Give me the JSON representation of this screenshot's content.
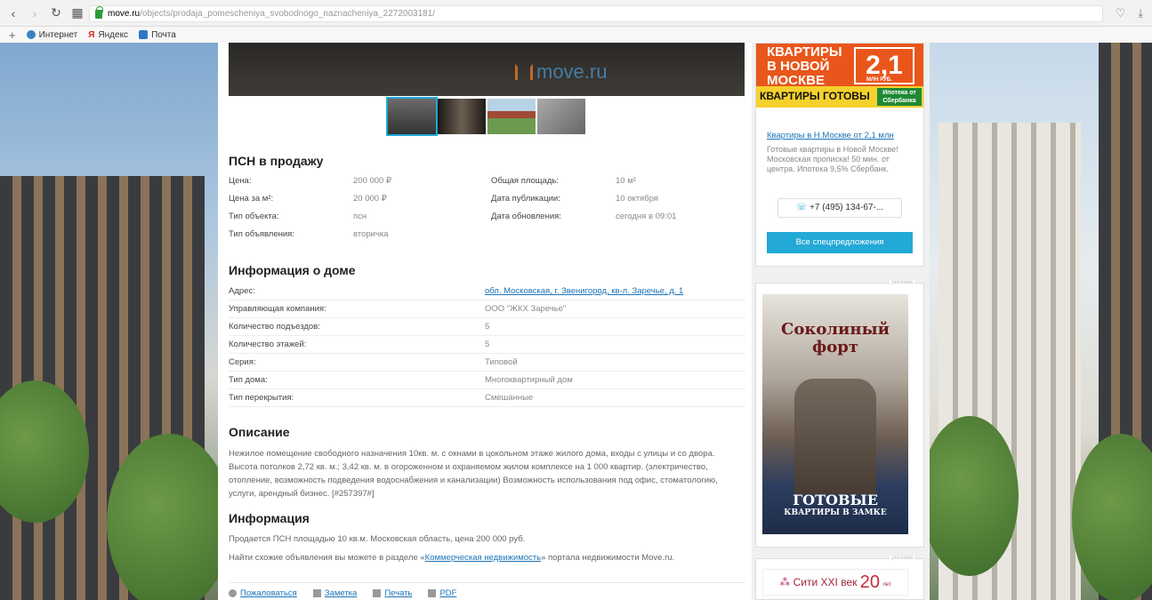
{
  "browser": {
    "url_host": "move.ru",
    "url_path": "/objects/prodaja_pomescheniya_svobodnogo_naznacheniya_2272003181/",
    "bookmarks": [
      "Интернет",
      "Яндекс",
      "Почта"
    ]
  },
  "listing": {
    "title": "ПСН в продажу",
    "details": [
      {
        "label": "Цена:",
        "value": "200 000 ₽"
      },
      {
        "label": "Цена за м²:",
        "value": "20 000 ₽"
      },
      {
        "label": "Тип объекта:",
        "value": "псн"
      },
      {
        "label": "Тип объявления:",
        "value": "вторичка"
      }
    ],
    "details_right": [
      {
        "label": "Общая площадь:",
        "value": "10 м²"
      },
      {
        "label": "Дата публикации:",
        "value": "10 октября"
      },
      {
        "label": "Дата обновления:",
        "value": "сегодня в 09:01"
      }
    ]
  },
  "house": {
    "title": "Информация о доме",
    "rows": [
      {
        "label": "Адрес:",
        "value": "обл. Московская, г. Звенигород, кв-л. Заречье, д. 1"
      },
      {
        "label": "Управляющая компания:",
        "value": "ООО \"ЖКХ Заречье\""
      },
      {
        "label": "Количество подъездов:",
        "value": "5"
      },
      {
        "label": "Количество этажей:",
        "value": "5"
      },
      {
        "label": "Серия:",
        "value": "Типовой"
      },
      {
        "label": "Тип дома:",
        "value": "Многоквартирный дом"
      },
      {
        "label": "Тип перекрытия:",
        "value": "Смешанные"
      }
    ]
  },
  "description": {
    "title": "Описание",
    "text": "Нежилое помещение свободного назначения 10кв. м. с окнами в цокольном этаже жилого дома, входы с улицы и со двора. Высота потолков 2,72 кв. м.; 3,42 кв. м. в огороженном и охраняемом жилом комплексе на 1 000 квартир. (электричество, отопление, возможность подведения водоснабжения и канализации) Возможность использования под офис, стоматологию, услуги, арендный бизнес. [#257397#]"
  },
  "info": {
    "title": "Информация",
    "line1": "Продается ПСН площадью 10 кв.м. Московская область, цена 200 000 руб.",
    "line2_pre": "Найти схожие объявления вы можете в разделе «",
    "line2_link": "Коммерческая недвижимость",
    "line2_post": "» портала недвижимости Move.ru."
  },
  "footer": {
    "complain": "Пожаловаться",
    "note": "Заметка",
    "print": "Печать",
    "pdf": "PDF"
  },
  "logo_text": "move.ru",
  "ad1": {
    "headline": "КВАРТИРЫ В НОВОЙ МОСКВЕ",
    "price_big": "2,1",
    "price_unit": "МЛН РУБ.",
    "bar_left": "КВАРТИРЫ ГОТОВЫ",
    "bar_right": "Ипотека от Сбербанка",
    "title": "Квартиры в Н.Москве от 2,1 млн",
    "text": "Готовые квартиры в Новой Москве! Московская прописка! 50 мин. от центра. Ипотека 9,5% Сбербанк.",
    "phone": "+7 (495) 134-67-...",
    "cta": "Все спецпредложения"
  },
  "ad_label": "реклама",
  "ad2": {
    "title": "Соколиный форт",
    "big": "ГОТОВЫЕ",
    "small": "КВАРТИРЫ В ЗАМКЕ"
  },
  "ad3": {
    "text": "Сити XXI век",
    "num": "20",
    "suffix": "лет"
  }
}
